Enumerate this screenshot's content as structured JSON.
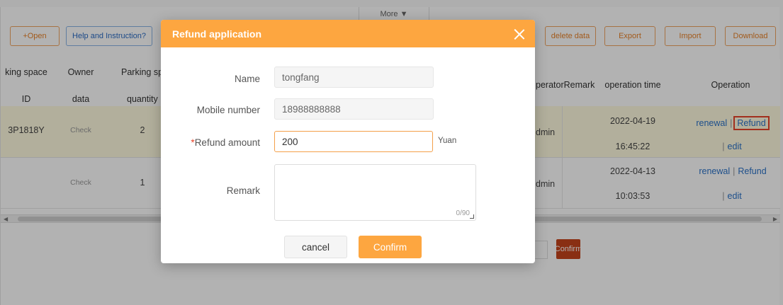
{
  "toolbar": {
    "open_label": "+Open",
    "help_label": "Help and Instruction?",
    "more_label": "More ▼",
    "delete_label": "delete data",
    "export_label": "Export",
    "import_label": "Import",
    "download_label": "Download"
  },
  "table": {
    "headers": {
      "space_id_1": "king space",
      "space_id_2": "ID",
      "owner_1": "Owner",
      "owner_2": "data",
      "parking_1": "Parking sp",
      "parking_2": "quantity",
      "operator_remark": "peratorRemark",
      "operation_time": "operation time",
      "operation": "Operation"
    },
    "rows": [
      {
        "space_id": "3P1818Y",
        "owner": "Check",
        "quantity": "2",
        "operator": "dmin",
        "date": "2022-04-19",
        "time": "16:45:22",
        "renewal": "renewal",
        "refund": "Refund",
        "edit": "edit"
      },
      {
        "space_id": "",
        "owner": "Check",
        "quantity": "1",
        "operator": "dmin",
        "date": "2022-04-13",
        "time": "10:03:53",
        "renewal": "renewal",
        "refund": "Refund",
        "edit": "edit"
      }
    ]
  },
  "pager": {
    "confirm_label": "Confirm"
  },
  "modal": {
    "title": "Refund application",
    "name_label": "Name",
    "name_value": "tongfang",
    "mobile_label": "Mobile number",
    "mobile_value": "18988888888",
    "amount_required": "*",
    "amount_label": "Refund amount",
    "amount_value": "200",
    "amount_unit": "Yuan",
    "remark_label": "Remark",
    "remark_counter": "0/90",
    "cancel_label": "cancel",
    "confirm_label": "Confirm"
  },
  "colors": {
    "accent": "#fda640",
    "highlight": "#e8442a",
    "link": "#2b72c8"
  }
}
